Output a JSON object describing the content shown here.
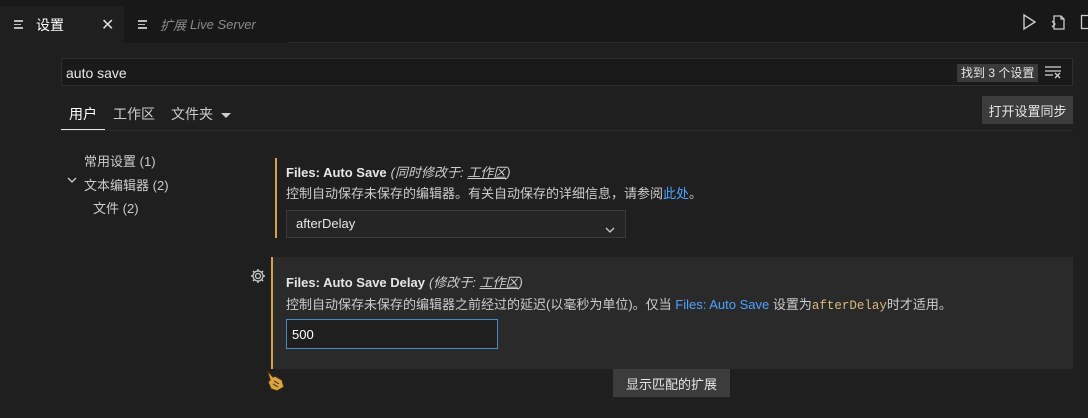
{
  "tabs": {
    "settings_label": "设置",
    "close_glyph": "✕",
    "extension_prefix": "扩展",
    "extension_name": "Live Server"
  },
  "search": {
    "value": "auto save",
    "result_count": "找到 3 个设置"
  },
  "scopes": [
    "用户",
    "工作区",
    "文件夹"
  ],
  "sync_button": "打开设置同步",
  "toc": [
    {
      "label": "常用设置",
      "count": "(1)"
    },
    {
      "label": "文本编辑器",
      "count": "(2)"
    },
    {
      "label": "文件",
      "count": "(2)"
    }
  ],
  "settings": [
    {
      "category": "Files: ",
      "name": "Auto Save",
      "modified_prefix": "(同时修改于: ",
      "modified_scope": "工作区",
      "modified_suffix": ")",
      "desc_before": "控制自动保存未保存的编辑器。有关自动保存的详细信息，请参阅",
      "desc_link": "此处",
      "desc_after": "。",
      "value": "afterDelay"
    },
    {
      "category": "Files: ",
      "name": "Auto Save Delay",
      "modified_prefix": "(修改于: ",
      "modified_scope": "工作区",
      "modified_suffix": ")",
      "desc_before": "控制自动保存未保存的编辑器之前经过的延迟(以毫秒为单位)。仅当 ",
      "desc_link": "Files: Auto Save",
      "desc_mid": " 设置为",
      "desc_code": "afterDelay",
      "desc_after": "时才适用。",
      "value": "500"
    }
  ],
  "show_extensions_button": "显示匹配的扩展",
  "colors": {
    "accent_modified": "#d6a24b",
    "link": "#4ea1ff",
    "code": "#d7ba7d",
    "focus_border": "#4a88c7"
  }
}
